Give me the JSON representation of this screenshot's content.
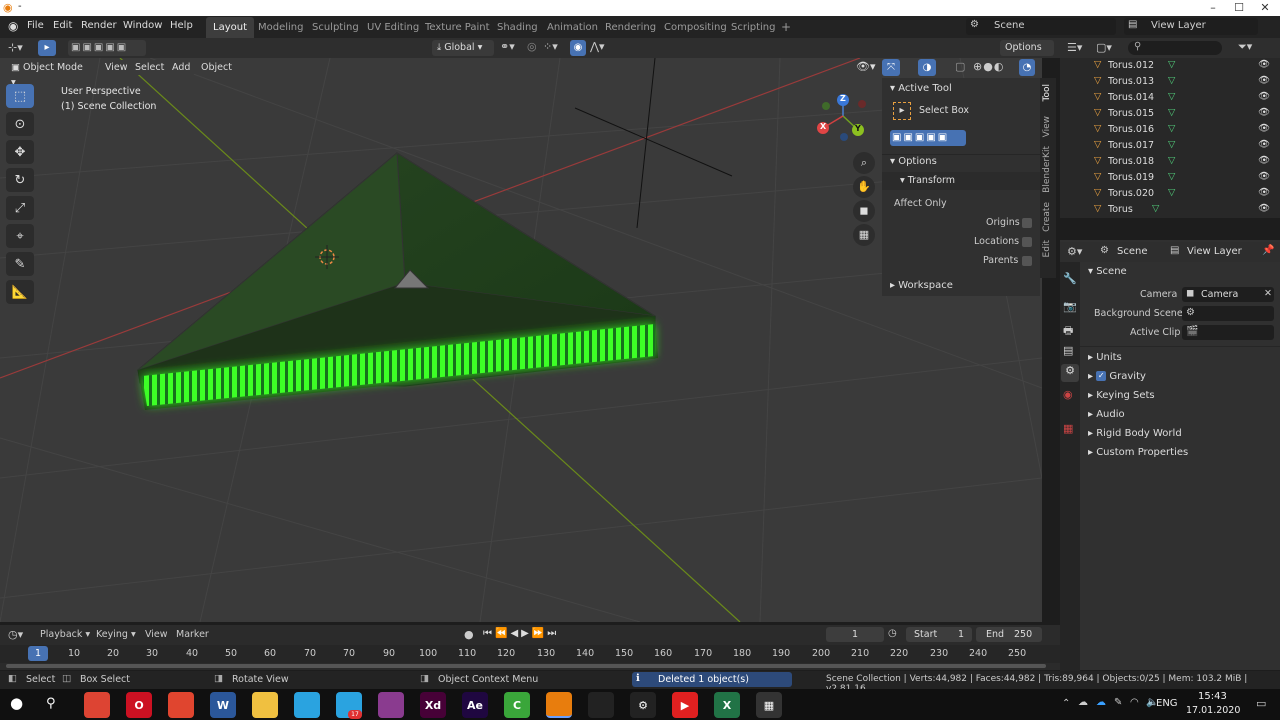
{
  "window": {
    "title": "-",
    "min": "–",
    "max": "☐",
    "close": "✕"
  },
  "menu": {
    "items": [
      "File",
      "Edit",
      "Render",
      "Window",
      "Help"
    ]
  },
  "workspaces": [
    "Layout",
    "Modeling",
    "Sculpting",
    "UV Editing",
    "Texture Paint",
    "Shading",
    "Animation",
    "Rendering",
    "Compositing",
    "Scripting"
  ],
  "workspace_add": "+",
  "scene": {
    "label": "Scene",
    "view_layer": "View Layer"
  },
  "viewport": {
    "mode": "Object Mode",
    "menus": [
      "View",
      "Select",
      "Add",
      "Object"
    ],
    "orientation": "Global",
    "options_label": "Options",
    "info_line1": "User Perspective",
    "info_line2": "(1) Scene Collection",
    "gizmo": {
      "z": "Z",
      "y": "Y",
      "x": "X"
    }
  },
  "npanel": {
    "active_tool_title": "Active Tool",
    "tool_name": "Select Box",
    "options_title": "Options",
    "transform_title": "Transform",
    "affect_only": "Affect Only",
    "origins": "Origins",
    "locations": "Locations",
    "parents": "Parents",
    "workspace_title": "Workspace",
    "tabs": [
      "Tool",
      "View",
      "BlenderKit",
      "Create",
      "Edit"
    ]
  },
  "outliner": {
    "items": [
      "Torus.012",
      "Torus.013",
      "Torus.014",
      "Torus.015",
      "Torus.016",
      "Torus.017",
      "Torus.018",
      "Torus.019",
      "Torus.020",
      "Torus"
    ]
  },
  "properties": {
    "scene_tab": "Scene",
    "view_layer_tab": "View Layer",
    "section": "Scene",
    "camera_label": "Camera",
    "camera_value": "Camera",
    "bg_scene_label": "Background Scene",
    "active_clip_label": "Active Clip",
    "subsections": [
      "Units",
      "Gravity",
      "Keying Sets",
      "Audio",
      "Rigid Body World",
      "Custom Properties"
    ],
    "gravity_checked": true
  },
  "timeline": {
    "menus": [
      "Playback",
      "Keying",
      "View",
      "Marker"
    ],
    "current_frame": "1",
    "start_label": "Start",
    "start_value": "1",
    "end_label": "End",
    "end_value": "250",
    "ticks": [
      "1",
      "10",
      "20",
      "30",
      "40",
      "50",
      "60",
      "70",
      "80",
      "90",
      "100",
      "110",
      "120",
      "130",
      "140",
      "150",
      "160",
      "170",
      "180",
      "190",
      "200",
      "210",
      "220",
      "230",
      "240",
      "250"
    ]
  },
  "statusbar": {
    "select": "Select",
    "box_select": "Box Select",
    "rotate_view": "Rotate View",
    "context_menu": "Object Context Menu",
    "message": "Deleted 1 object(s)",
    "stats": "Scene Collection | Verts:44,982 | Faces:44,982 | Tris:89,964 | Objects:0/25 | Mem: 103.2 MiB | v2.81.16"
  },
  "taskbar": {
    "lang": "ENG",
    "time": "15:43",
    "date": "17.01.2020",
    "telegram_badge": "17",
    "apps": [
      {
        "name": "chrome",
        "label": "",
        "color": "#dd4433"
      },
      {
        "name": "opera",
        "label": "O",
        "color": "#cc1122"
      },
      {
        "name": "app-red",
        "label": "",
        "color": "#e0452f"
      },
      {
        "name": "word",
        "label": "W",
        "color": "#2b579a"
      },
      {
        "name": "explorer",
        "label": "",
        "color": "#f0c040"
      },
      {
        "name": "telegram",
        "label": "",
        "color": "#2aa3e0"
      },
      {
        "name": "telegram2",
        "label": "",
        "color": "#2aa3e0"
      },
      {
        "name": "winrar",
        "label": "",
        "color": "#8a3b8f"
      },
      {
        "name": "xd",
        "label": "Xd",
        "color": "#470137"
      },
      {
        "name": "aftereffects",
        "label": "Ae",
        "color": "#1f0740"
      },
      {
        "name": "camtasia",
        "label": "C",
        "color": "#3aa63a"
      },
      {
        "name": "blender",
        "label": "",
        "color": "#e87d0d"
      },
      {
        "name": "unity",
        "label": "",
        "color": "#222222"
      },
      {
        "name": "settings",
        "label": "⚙",
        "color": "#222222"
      },
      {
        "name": "media",
        "label": "▶",
        "color": "#e02020"
      },
      {
        "name": "excel",
        "label": "X",
        "color": "#217346"
      },
      {
        "name": "calculator",
        "label": "▦",
        "color": "#333333"
      }
    ]
  }
}
